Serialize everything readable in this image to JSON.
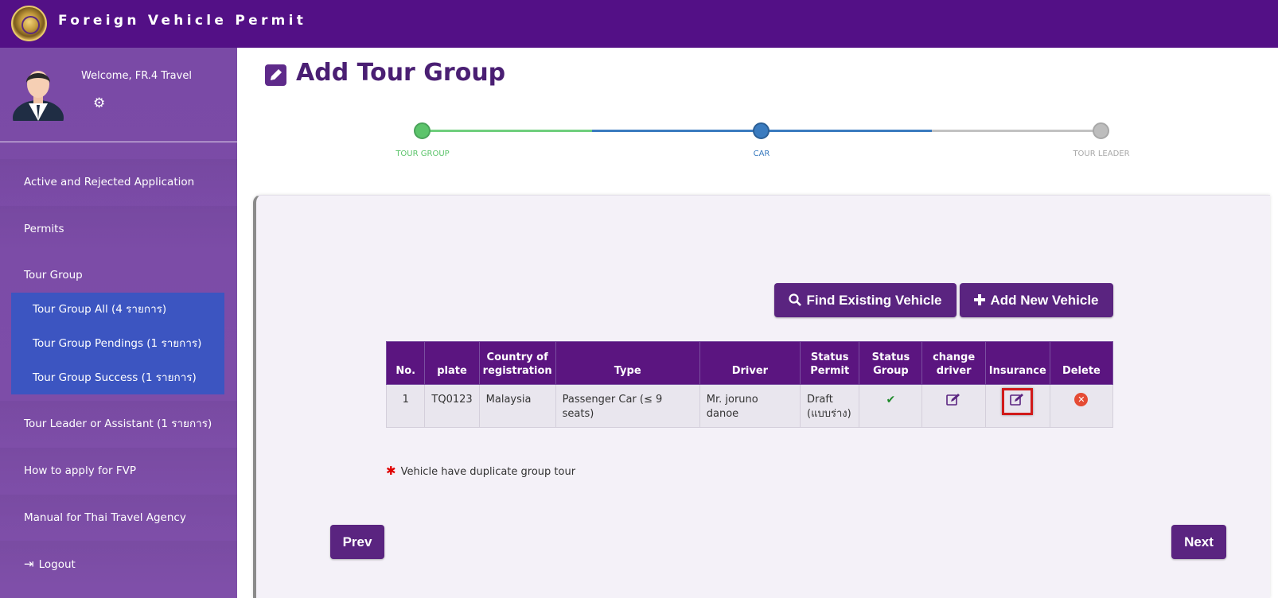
{
  "app": {
    "title": "Foreign Vehicle Permit"
  },
  "sidebar": {
    "welcome": "Welcome, FR.4 Travel",
    "items": [
      {
        "label": "Active and Rejected Application"
      },
      {
        "label": "Permits"
      },
      {
        "label": "Tour Group"
      },
      {
        "label": "Tour Leader or Assistant (1 รายการ)"
      },
      {
        "label": "How to apply for FVP"
      },
      {
        "label": "Manual for Thai Travel Agency"
      },
      {
        "label": "Logout"
      }
    ],
    "submenu": [
      {
        "label": "Tour Group All (4 รายการ)"
      },
      {
        "label": "Tour Group Pendings (1 รายการ)"
      },
      {
        "label": "Tour Group Success (1 รายการ)"
      }
    ]
  },
  "main": {
    "title": "Add Tour Group",
    "steps": [
      {
        "label": "TOUR GROUP",
        "state": "done"
      },
      {
        "label": "CAR",
        "state": "active"
      },
      {
        "label": "TOUR LEADER",
        "state": "pending"
      }
    ],
    "buttons": {
      "find_existing": "Find Existing Vehicle",
      "add_new": "Add New Vehicle",
      "prev": "Prev",
      "next": "Next"
    },
    "table": {
      "headers": [
        "No.",
        "plate",
        "Country of registration",
        "Type",
        "Driver",
        "Status Permit",
        "Status Group",
        "change driver",
        "Insurance",
        "Delete"
      ],
      "rows": [
        {
          "no": "1",
          "plate": "TQ0123",
          "country": "Malaysia",
          "type": "Passenger Car (≤ 9 seats)",
          "driver": "Mr. joruno danoe",
          "status_permit": "Draft (แบบร่าง)",
          "status_group": "check-icon"
        }
      ]
    },
    "note": "Vehicle have duplicate group tour"
  },
  "colors": {
    "topbar": "#531086",
    "sidebar": "#7a4aa6",
    "submenu": "#3c55c1",
    "button": "#5a2480",
    "step_done": "#5cc46b",
    "step_active": "#3a7bbf",
    "step_pending": "#bdbdbd"
  }
}
